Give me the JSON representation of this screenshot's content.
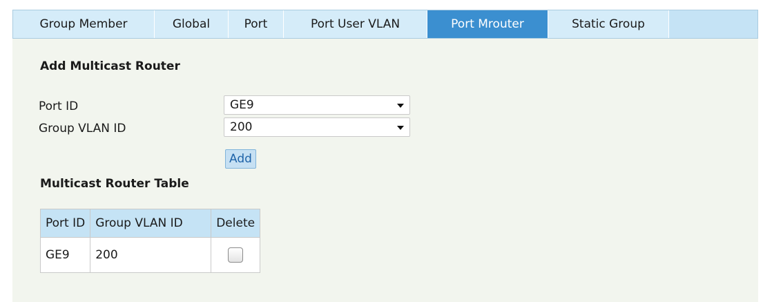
{
  "tabs": [
    {
      "label": "Group Member",
      "active": false
    },
    {
      "label": "Global",
      "active": false
    },
    {
      "label": "Port",
      "active": false
    },
    {
      "label": "Port User VLAN",
      "active": false
    },
    {
      "label": "Port Mrouter",
      "active": true
    },
    {
      "label": "Static Group",
      "active": false
    }
  ],
  "add_section": {
    "title": "Add Multicast Router",
    "port_id_label": "Port ID",
    "port_id_value": "GE9",
    "group_vlan_label": "Group VLAN ID",
    "group_vlan_value": "200",
    "add_button": "Add"
  },
  "table_section": {
    "title": "Multicast Router Table",
    "headers": [
      "Port ID",
      "Group VLAN ID",
      "Delete"
    ],
    "rows": [
      {
        "port_id": "GE9",
        "group_vlan_id": "200",
        "delete_checked": false
      }
    ]
  },
  "colors": {
    "tab_bar": "#c5e3f5",
    "active_tab": "#3b8fd0",
    "panel": "#f2f5ee",
    "button": "#c6e0f3"
  }
}
